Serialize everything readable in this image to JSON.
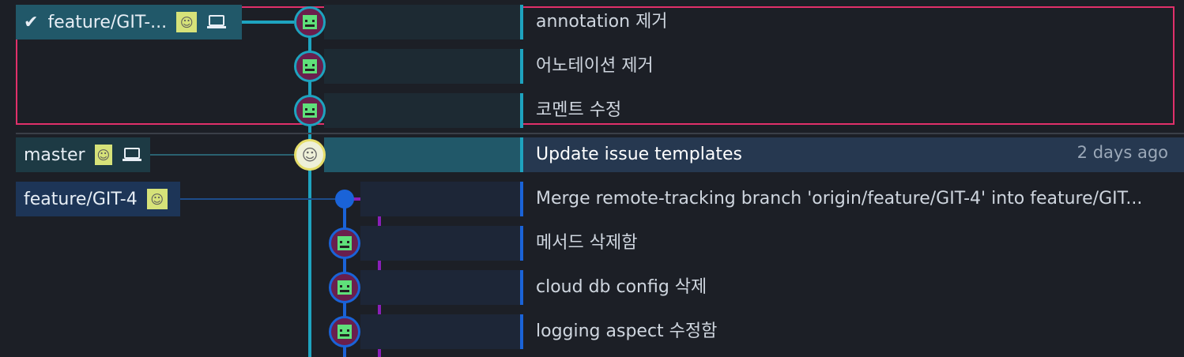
{
  "branches": {
    "current": {
      "label": "feature/GIT-...",
      "check_icon": "check-icon",
      "avatar_icon": "user-avatar-icon",
      "local_icon": "laptop-icon"
    },
    "master": {
      "label": "master",
      "avatar_icon": "user-avatar-icon",
      "local_icon": "laptop-icon"
    },
    "remote": {
      "label": "feature/GIT-4",
      "avatar_icon": "user-avatar-icon"
    }
  },
  "commits": [
    {
      "message": "annotation 제거"
    },
    {
      "message": "어노테이션 제거"
    },
    {
      "message": "코멘트 수정"
    },
    {
      "message": "Update issue templates",
      "time": "2 days ago"
    },
    {
      "message": "Merge remote-tracking branch 'origin/feature/GIT-4' into feature/GIT..."
    },
    {
      "message": "메서드 삭제함"
    },
    {
      "message": "cloud db config 삭제"
    },
    {
      "message": "logging aspect 수정함"
    }
  ],
  "colors": {
    "teal": "#1ea3bf",
    "blue": "#1a63d8",
    "purple": "#8a1fb8",
    "selection": "#e0306a",
    "background": "#1c1f26"
  }
}
